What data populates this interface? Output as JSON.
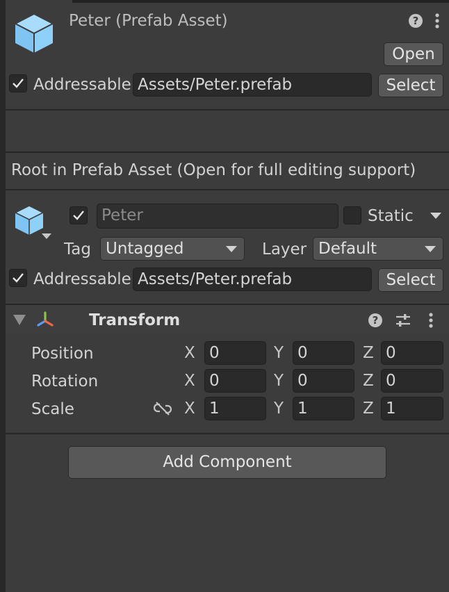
{
  "header": {
    "title": "Peter (Prefab Asset)",
    "open_label": "Open",
    "addressable_label": "Addressable",
    "addressable_checked": true,
    "address_value": "Assets/Peter.prefab",
    "select_label": "Select"
  },
  "notice": "Root in Prefab Asset (Open for full editing support)",
  "gameobject": {
    "active_checked": true,
    "name_value": "Peter",
    "static_label": "Static",
    "static_checked": false,
    "tag_label": "Tag",
    "tag_value": "Untagged",
    "layer_label": "Layer",
    "layer_value": "Default",
    "addressable_label": "Addressable",
    "addressable_checked": true,
    "address_value": "Assets/Peter.prefab",
    "select_label": "Select"
  },
  "transform": {
    "title": "Transform",
    "rows": [
      {
        "label": "Position",
        "x": "0",
        "y": "0",
        "z": "0"
      },
      {
        "label": "Rotation",
        "x": "0",
        "y": "0",
        "z": "0"
      },
      {
        "label": "Scale",
        "x": "1",
        "y": "1",
        "z": "1"
      }
    ],
    "axis_x": "X",
    "axis_y": "Y",
    "axis_z": "Z"
  },
  "add_component_label": "Add Component",
  "colors": {
    "prefab_icon": "#7fc4f2",
    "panel_bg": "#3c3c3c",
    "field_bg": "#2a2a2a",
    "button_bg": "#585858"
  },
  "icons": [
    "prefab-cube-icon",
    "help-icon",
    "kebab-menu-icon",
    "checkmark-icon",
    "transform-axes-icon",
    "preset-sliders-icon",
    "unlinked-chain-icon",
    "foldout-triangle-icon",
    "dropdown-caret-icon"
  ]
}
